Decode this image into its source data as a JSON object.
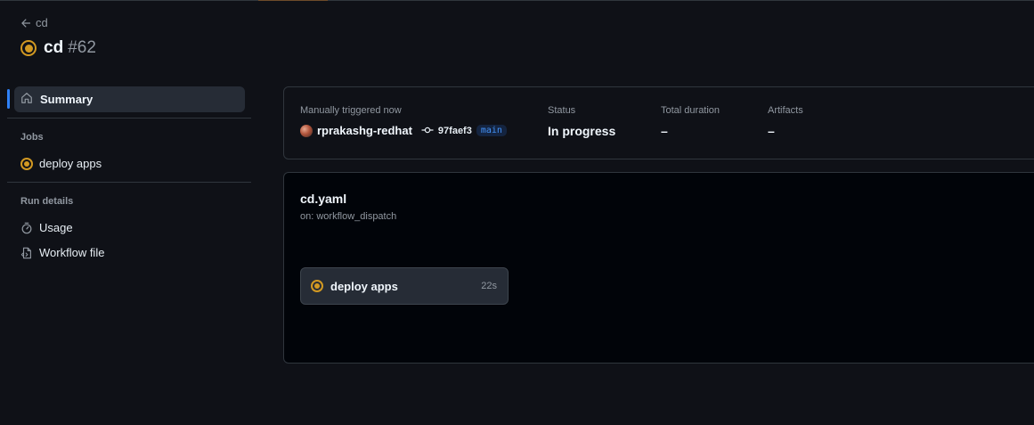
{
  "header": {
    "back_label": "cd",
    "workflow_name": "cd",
    "run_number": "#62",
    "status_color": "#d29922"
  },
  "sidebar": {
    "summary_label": "Summary",
    "jobs_heading": "Jobs",
    "jobs": [
      {
        "label": "deploy apps",
        "icon": "in-progress-icon"
      }
    ],
    "run_details_heading": "Run details",
    "run_details": [
      {
        "label": "Usage",
        "icon": "stopwatch-icon"
      },
      {
        "label": "Workflow file",
        "icon": "file-code-icon"
      }
    ],
    "active_accent": "#2f81f7"
  },
  "summary": {
    "trigger_label": "Manually triggered now",
    "actor": "rprakashg-redhat",
    "commit_sha": "97faef3",
    "branch": "main",
    "status_label": "Status",
    "status_value": "In progress",
    "duration_label": "Total duration",
    "duration_value": "–",
    "artifacts_label": "Artifacts",
    "artifacts_value": "–"
  },
  "graph": {
    "file_name": "cd.yaml",
    "trigger": "on: workflow_dispatch",
    "jobs": [
      {
        "label": "deploy apps",
        "duration": "22s"
      }
    ]
  }
}
